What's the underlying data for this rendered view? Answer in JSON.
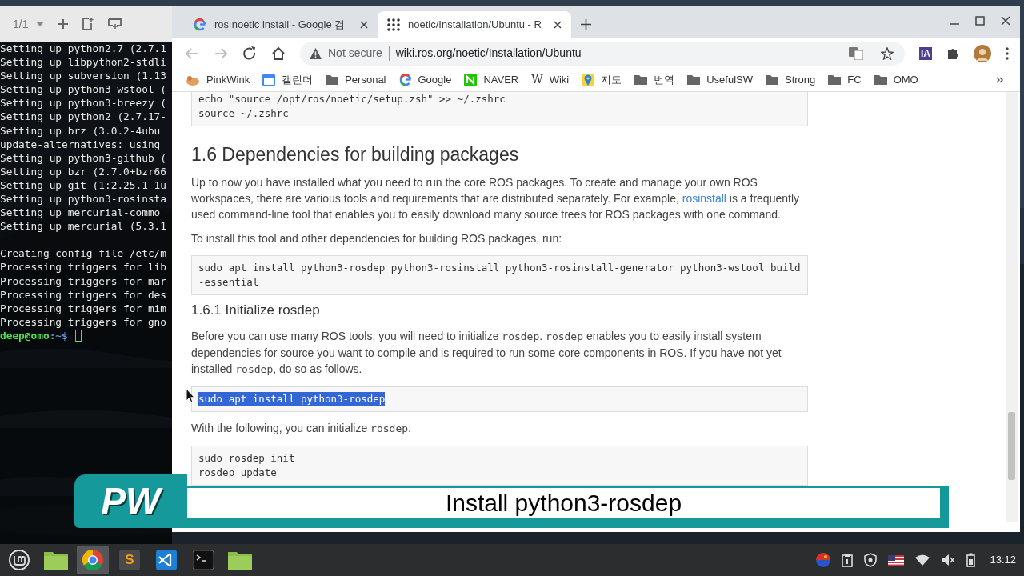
{
  "terminal": {
    "tab_counter": "1/1",
    "output_blocks": [
      {
        "lines": [
          "Setting up python2.7 (2.7.1",
          "Setting up libpython2-stdli",
          "Setting up subversion (1.13",
          "Setting up python3-wstool (",
          "Setting up python3-breezy (",
          "Setting up python2 (2.7.17-",
          "Setting up brz (3.0.2-4ubu",
          "update-alternatives: using",
          "Setting up python3-github (",
          "Setting up bzr (2.7.0+bzr66",
          "Setting up git (1:2.25.1-1u",
          "Setting up python3-rosinsta",
          "Setting up mercurial-commo",
          "Setting up mercurial (5.3.1"
        ]
      },
      {
        "lines": [
          "Creating config file /etc/m",
          "Processing triggers for lib",
          "Processing triggers for mar",
          "Processing triggers for des",
          "Processing triggers for mim",
          "Processing triggers for gno"
        ]
      }
    ],
    "prompt": {
      "user": "deep@omo",
      "path": ":~$"
    }
  },
  "browser": {
    "tabs": [
      {
        "title": "ros noetic install - Google 검",
        "kind": "google",
        "selected": false
      },
      {
        "title": "noetic/Installation/Ubuntu - R",
        "kind": "grid",
        "selected": true
      }
    ],
    "nav": [
      {
        "kind": "back",
        "disabled": true
      },
      {
        "kind": "forward",
        "disabled": true
      },
      {
        "kind": "reload",
        "disabled": false
      },
      {
        "kind": "home",
        "disabled": false
      }
    ],
    "address": {
      "security": "Not secure",
      "url": "wiki.ros.org/noetic/Installation/Ubuntu"
    },
    "extension_label": "IA",
    "bookmarks": [
      {
        "label": "PinkWink",
        "kind": "site"
      },
      {
        "label": "캘린더",
        "kind": "calendar"
      },
      {
        "label": "Personal",
        "kind": "folder"
      },
      {
        "label": "Google",
        "kind": "google"
      },
      {
        "label": "NAVER",
        "kind": "naver"
      },
      {
        "label": "Wiki",
        "kind": "wiki",
        "glyph": "W"
      },
      {
        "label": "지도",
        "kind": "map"
      },
      {
        "label": "번역",
        "kind": "folder"
      },
      {
        "label": "UsefulSW",
        "kind": "folder"
      },
      {
        "label": "Strong",
        "kind": "folder"
      },
      {
        "label": "FC",
        "kind": "folder"
      },
      {
        "label": "OMO",
        "kind": "folder"
      }
    ],
    "page": [
      {
        "kind": "code",
        "selected": false,
        "lines": [
          "echo \"source /opt/ros/noetic/setup.zsh\" >> ~/.zshrc",
          "source ~/.zshrc"
        ]
      },
      {
        "kind": "h2",
        "text": "1.6 Dependencies for building packages"
      },
      {
        "kind": "p",
        "segments": [
          {
            "kind": "text",
            "text": "Up to now you have installed what you need to run the core ROS packages. To create and manage your own ROS workspaces, there are various tools and requirements that are distributed separately. For example, "
          },
          {
            "kind": "link",
            "text": "rosinstall"
          },
          {
            "kind": "text",
            "text": " is a frequently used command-line tool that enables you to easily download many source trees for ROS packages with one command."
          }
        ]
      },
      {
        "kind": "p",
        "segments": [
          {
            "kind": "text",
            "text": "To install this tool and other dependencies for building ROS packages, run:"
          }
        ]
      },
      {
        "kind": "code",
        "selected": false,
        "lines": [
          "sudo apt install python3-rosdep python3-rosinstall python3-rosinstall-generator python3-wstool build-essential"
        ]
      },
      {
        "kind": "h3",
        "text": "1.6.1 Initialize rosdep"
      },
      {
        "kind": "p",
        "segments": [
          {
            "kind": "text",
            "text": "Before you can use many ROS tools, you will need to initialize "
          },
          {
            "kind": "code",
            "text": "rosdep"
          },
          {
            "kind": "text",
            "text": ". "
          },
          {
            "kind": "code",
            "text": "rosdep"
          },
          {
            "kind": "text",
            "text": " enables you to easily install system dependencies for source you want to compile and is required to run some core components in ROS. If you have not yet installed "
          },
          {
            "kind": "code",
            "text": "rosdep"
          },
          {
            "kind": "text",
            "text": ", do so as follows."
          }
        ]
      },
      {
        "kind": "code",
        "selected": true,
        "lines": [
          "sudo apt install python3-rosdep"
        ]
      },
      {
        "kind": "p",
        "segments": [
          {
            "kind": "text",
            "text": "With the following, you can initialize "
          },
          {
            "kind": "code",
            "text": "rosdep"
          },
          {
            "kind": "text",
            "text": "."
          }
        ]
      },
      {
        "kind": "code",
        "selected": false,
        "lines": [
          "sudo rosdep init",
          "rosdep update"
        ]
      }
    ]
  },
  "caption": {
    "logo": "PW",
    "text": "Install python3-rosdep"
  },
  "taskbar": {
    "apps": [
      {
        "kind": "menu",
        "selected": false
      },
      {
        "kind": "files",
        "selected": false
      },
      {
        "kind": "chrome",
        "selected": true
      },
      {
        "kind": "sublime",
        "glyph": "S",
        "selected": false
      },
      {
        "kind": "vscode",
        "selected": false
      },
      {
        "kind": "terminal",
        "selected": false
      },
      {
        "kind": "folder",
        "selected": false
      }
    ],
    "clock": "13:12"
  }
}
